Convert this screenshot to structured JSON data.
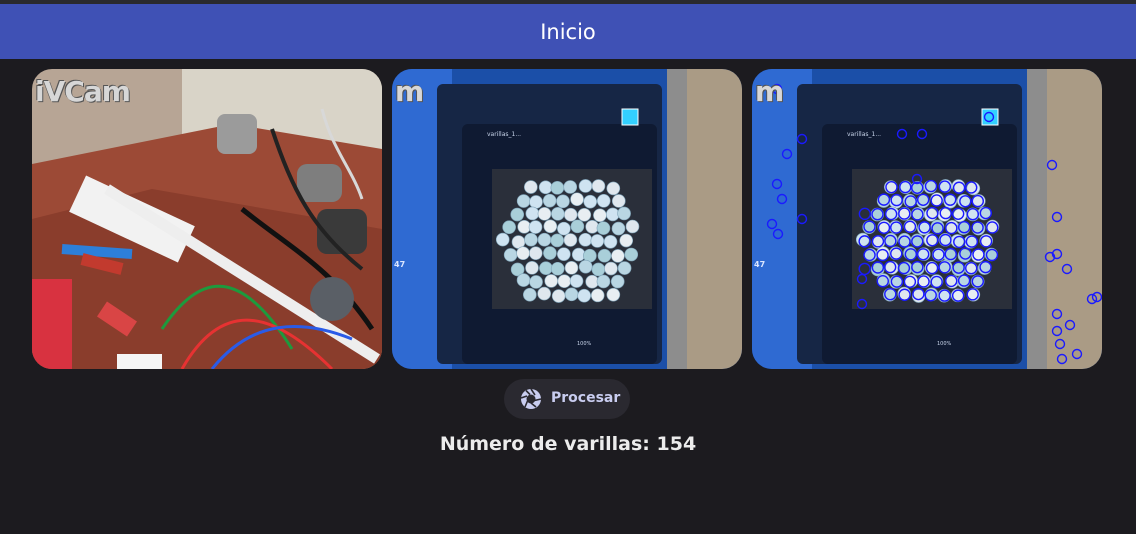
{
  "appbar": {
    "title": "Inicio"
  },
  "camera_frames": [
    {
      "watermark": "iVCam",
      "kind": "raw-camera-feed"
    },
    {
      "watermark": "m",
      "kind": "input-image"
    },
    {
      "watermark": "m",
      "kind": "detection-result"
    }
  ],
  "screen_labels": {
    "tab_title": "varillas_1...",
    "zoom": "100%",
    "side_number": "47"
  },
  "process_button": {
    "label": "Procesar",
    "icon": "shutter-icon"
  },
  "result": {
    "text": "Número de varillas: 154"
  },
  "colors": {
    "appbar": "#3f51b5",
    "background": "#1c1b1f",
    "button_bg": "#2a2930",
    "button_text": "#c9cdf0",
    "detection_circle": "#1a1aff"
  }
}
